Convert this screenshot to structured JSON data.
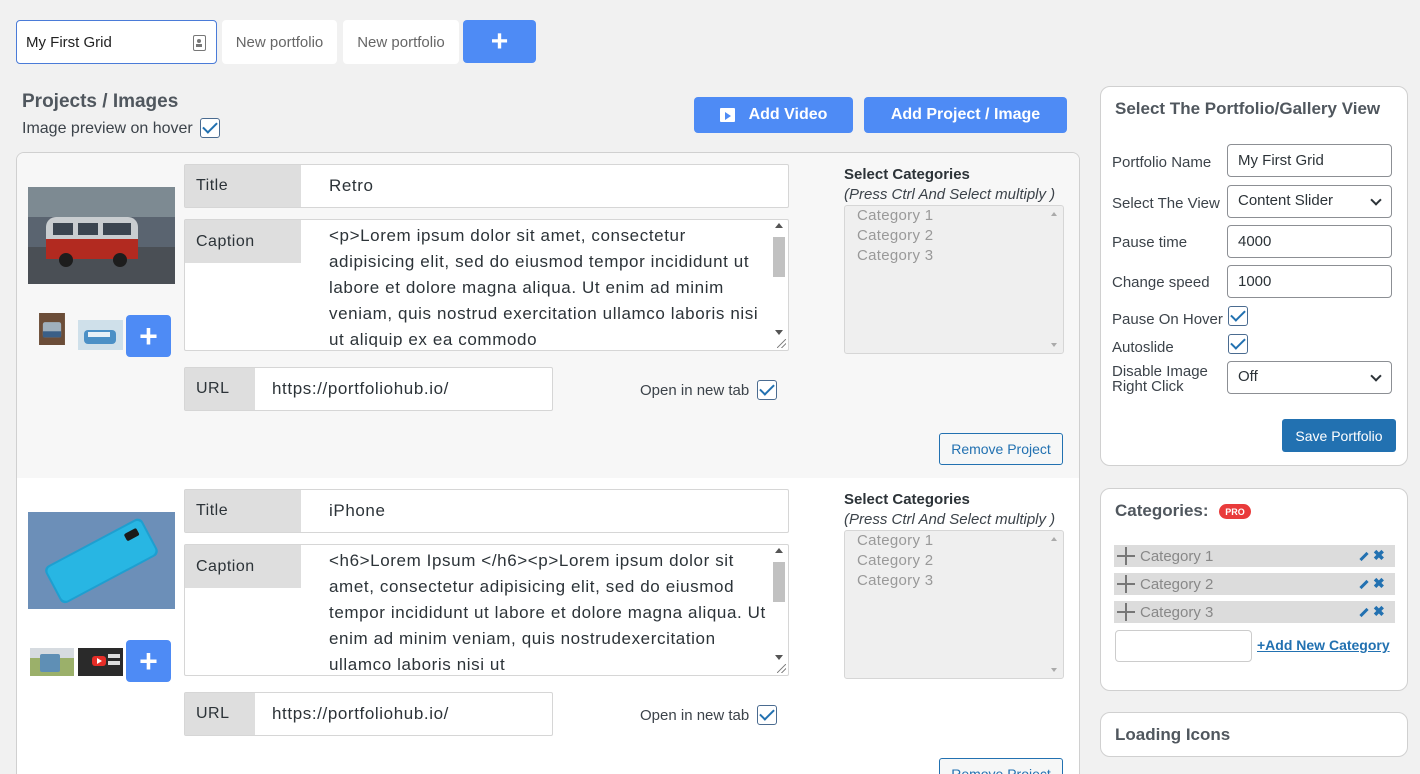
{
  "tabs": {
    "active": "My First Grid",
    "others": [
      "New portfolio",
      "New portfolio"
    ],
    "add_label": "+"
  },
  "projects_section": {
    "title": "Projects / Images",
    "hover_label": "Image preview on hover",
    "hover_checked": true,
    "add_video": "Add Video",
    "add_project": "Add Project / Image"
  },
  "projects": [
    {
      "title_label": "Title",
      "title": "Retro",
      "caption_label": "Caption",
      "caption": "<p>Lorem ipsum dolor sit amet, consectetur adipisicing elit, sed do eiusmod tempor incididunt ut labore et dolore magna aliqua. Ut enim ad minim veniam, quis nostrud exercitation ullamco laboris nisi ut aliquip ex ea commodo",
      "url_label": "URL",
      "url": "https://portfoliohub.io/",
      "new_tab_label": "Open in new tab",
      "new_tab_checked": true,
      "categories_heading": "Select Categories",
      "categories_hint": "(Press Ctrl And Select multiply )",
      "categories": [
        "Category 1",
        "Category 2",
        "Category 3"
      ],
      "remove_label": "Remove Project",
      "plus_label": "+"
    },
    {
      "title_label": "Title",
      "title": "iPhone",
      "caption_label": "Caption",
      "caption": "<h6>Lorem Ipsum </h6><p>Lorem ipsum dolor sit amet, consectetur adipisicing elit, sed do eiusmod tempor incididunt ut labore et dolore magna aliqua. Ut enim ad minim veniam, quis nostrudexercitation ullamco laboris nisi ut",
      "url_label": "URL",
      "url": "https://portfoliohub.io/",
      "new_tab_label": "Open in new tab",
      "new_tab_checked": true,
      "categories_heading": "Select Categories",
      "categories_hint": "(Press Ctrl And Select multiply )",
      "categories": [
        "Category 1",
        "Category 2",
        "Category 3"
      ],
      "remove_label": "Remove Project",
      "plus_label": "+"
    }
  ],
  "settings": {
    "title": "Select The Portfolio/Gallery View",
    "portfolio_name_label": "Portfolio Name",
    "portfolio_name": "My First Grid",
    "view_label": "Select The View",
    "view": "Content Slider",
    "pause_time_label": "Pause time",
    "pause_time": "4000",
    "change_speed_label": "Change speed",
    "change_speed": "1000",
    "pause_hover_label": "Pause On Hover",
    "pause_hover_checked": true,
    "autoslide_label": "Autoslide",
    "autoslide_checked": true,
    "disable_rc_label_1": "Disable Image",
    "disable_rc_label_2": "Right Click",
    "disable_rc": "Off",
    "save_label": "Save Portfolio"
  },
  "categories_panel": {
    "title": "Categories:",
    "badge": "PRO",
    "items": [
      "Category 1",
      "Category 2",
      "Category 3"
    ],
    "add_link": "+Add New Category"
  },
  "loading_panel": {
    "title": "Loading Icons"
  },
  "colors": {
    "accent": "#4e8bf5",
    "wp_blue": "#2271b1",
    "pro_badge": "#e93b3b"
  }
}
